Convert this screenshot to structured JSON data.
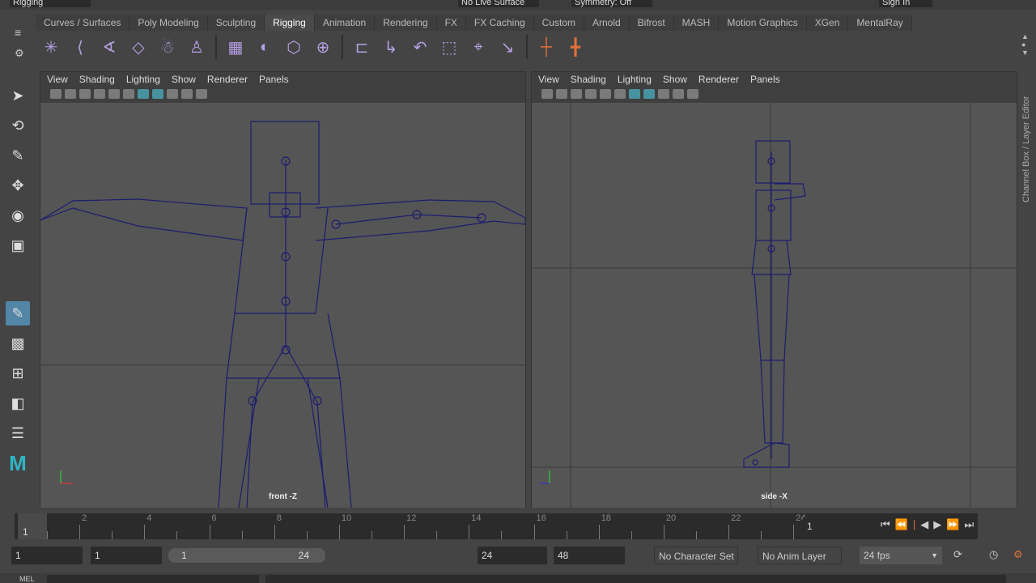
{
  "status_line": {
    "menu_set": "Rigging",
    "live_surface": "No Live Surface",
    "symmetry": "Symmetry: Off",
    "sign_in": "Sign In"
  },
  "shelf_tabs": [
    "Curves / Surfaces",
    "Poly Modeling",
    "Sculpting",
    "Rigging",
    "Animation",
    "Rendering",
    "FX",
    "FX Caching",
    "Custom",
    "Arnold",
    "Bifrost",
    "MASH",
    "Motion Graphics",
    "XGen",
    "MentalRay"
  ],
  "active_shelf": "Rigging",
  "panels": [
    {
      "menus": [
        "View",
        "Shading",
        "Lighting",
        "Show",
        "Renderer",
        "Panels"
      ],
      "camera_label": "front -Z"
    },
    {
      "menus": [
        "View",
        "Shading",
        "Lighting",
        "Show",
        "Renderer",
        "Panels"
      ],
      "camera_label": "side -X"
    }
  ],
  "side_tab": "Channel Box / Layer Editor",
  "timeline": {
    "current_frame_marker": "1",
    "tick_labels": [
      "2",
      "4",
      "6",
      "8",
      "10",
      "12",
      "14",
      "16",
      "18",
      "20",
      "22",
      "24"
    ],
    "current_frame": "1"
  },
  "range": {
    "start": "1",
    "playback_start": "1",
    "slider_start": "1",
    "slider_end": "24",
    "playback_end": "24",
    "end": "48",
    "character_set": "No Character Set",
    "anim_layer": "No Anim Layer",
    "fps": "24 fps"
  },
  "command_line": {
    "label": "MEL"
  },
  "colors": {
    "accent": "#5285a6",
    "wire": "#1c1c70",
    "shelf_icon": "#b59fe3",
    "timeline_marker": "#e0703a"
  }
}
